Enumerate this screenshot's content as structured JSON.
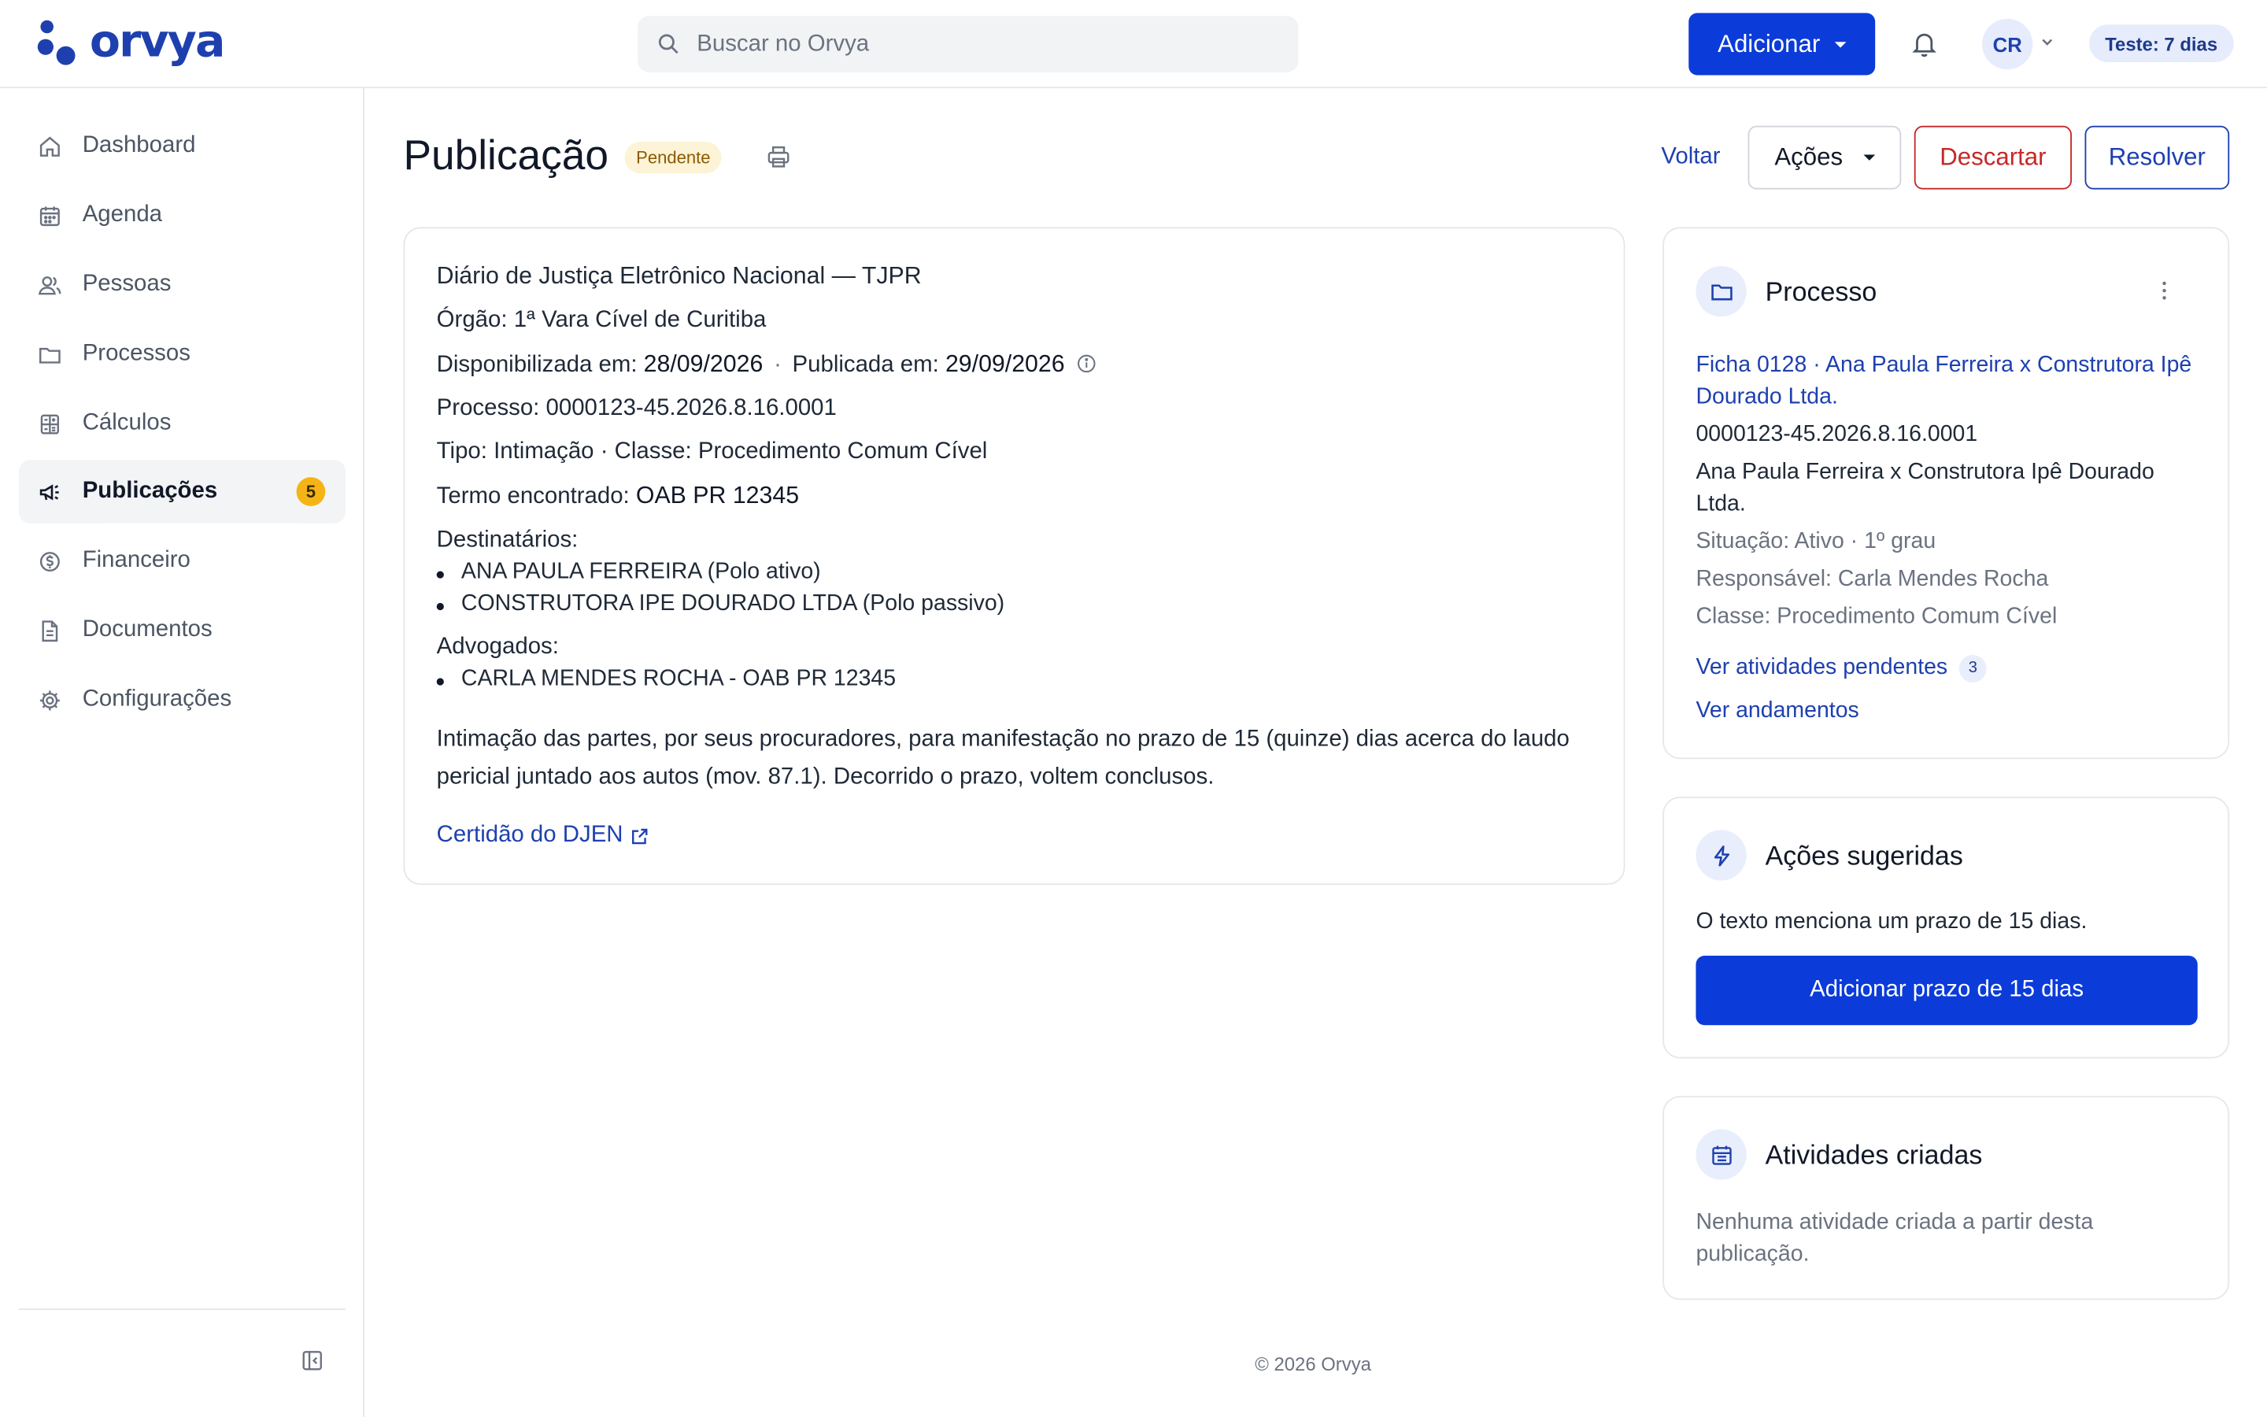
{
  "brand": {
    "name": "orvya",
    "color": "#1e40af"
  },
  "header": {
    "search_placeholder": "Buscar no Orvya",
    "add_button": "Adicionar",
    "avatar_initials": "CR",
    "trial_badge": "Teste: 7 dias"
  },
  "sidebar": {
    "items": [
      {
        "label": "Dashboard",
        "icon": "home-icon"
      },
      {
        "label": "Agenda",
        "icon": "calendar-icon"
      },
      {
        "label": "Pessoas",
        "icon": "people-icon"
      },
      {
        "label": "Processos",
        "icon": "folder-icon"
      },
      {
        "label": "Cálculos",
        "icon": "calculator-icon"
      },
      {
        "label": "Publicações",
        "icon": "megaphone-icon",
        "badge": "5",
        "active": true
      },
      {
        "label": "Financeiro",
        "icon": "dollar-icon"
      },
      {
        "label": "Documentos",
        "icon": "document-icon"
      },
      {
        "label": "Configurações",
        "icon": "gear-icon"
      }
    ]
  },
  "page": {
    "title": "Publicação",
    "status": "Pendente",
    "back_link": "Voltar",
    "actions_button": "Ações",
    "discard_button": "Descartar",
    "resolve_button": "Resolver"
  },
  "publication": {
    "journal": "Diário de Justiça Eletrônico Nacional — TJPR",
    "orgao_label": "Órgão:",
    "orgao": "1ª Vara Cível de Curitiba",
    "disponibilizada_label": "Disponibilizada em:",
    "disponibilizada": "28/09/2026",
    "separator": "·",
    "publicada_label": "Publicada em:",
    "publicada": "29/09/2026",
    "processo_label": "Processo:",
    "processo": "0000123-45.2026.8.16.0001",
    "tipo_label": "Tipo:",
    "tipo": "Intimação",
    "classe_label": "Classe:",
    "classe": "Procedimento Comum Cível",
    "termo_label": "Termo encontrado:",
    "termo": "OAB PR 12345",
    "destinatarios_label": "Destinatários:",
    "destinatarios": [
      "ANA PAULA FERREIRA (Polo ativo)",
      "CONSTRUTORA IPE DOURADO LTDA (Polo passivo)"
    ],
    "advogados_label": "Advogados:",
    "advogados": [
      "CARLA MENDES ROCHA - OAB PR 12345"
    ],
    "text": "Intimação das partes, por seus procuradores, para manifestação no prazo de 15 (quinze) dias acerca do laudo pericial juntado aos autos (mov. 87.1). Decorrido o prazo, voltem conclusos.",
    "certidao_link": "Certidão do DJEN"
  },
  "processo_card": {
    "title": "Processo",
    "link": "Ficha 0128 · Ana Paula Ferreira x Construtora Ipê Dourado Ltda.",
    "number": "0000123-45.2026.8.16.0001",
    "parties": "Ana Paula Ferreira x Construtora Ipê Dourado Ltda.",
    "situacao": "Situação: Ativo · 1º grau",
    "responsavel": "Responsável: Carla Mendes Rocha",
    "classe": "Classe: Procedimento Comum Cível",
    "atividades_link": "Ver atividades pendentes",
    "atividades_count": "3",
    "andamentos_link": "Ver andamentos"
  },
  "acoes_card": {
    "title": "Ações sugeridas",
    "text": "O texto menciona um prazo de 15 dias.",
    "button": "Adicionar prazo de 15 dias"
  },
  "atividades_card": {
    "title": "Atividades criadas",
    "text": "Nenhuma atividade criada a partir desta publicação."
  },
  "footer": "© 2026 Orvya"
}
